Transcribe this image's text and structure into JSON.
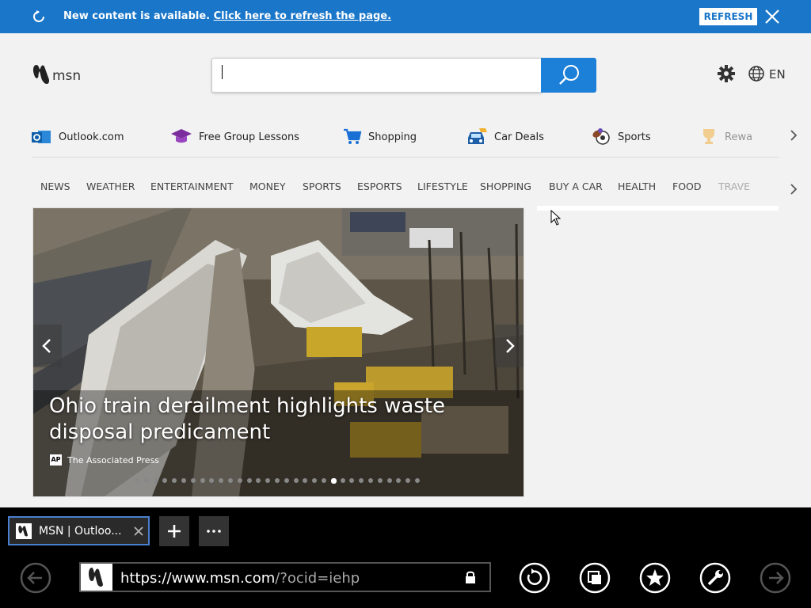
{
  "banner": {
    "message": "New content is available.",
    "link": "Click here to refresh the page.",
    "refresh_label": "REFRESH"
  },
  "header": {
    "logo_text": "msn",
    "search_value": "",
    "language": "EN"
  },
  "quick_links": [
    {
      "label": "Outlook.com",
      "icon": "outlook-icon"
    },
    {
      "label": "Free Group Lessons",
      "icon": "graduation-cap-icon"
    },
    {
      "label": "Shopping",
      "icon": "shopping-cart-icon"
    },
    {
      "label": "Car Deals",
      "icon": "car-icon"
    },
    {
      "label": "Sports",
      "icon": "sports-balls-icon"
    },
    {
      "label": "Rewa",
      "icon": "trophy-icon"
    }
  ],
  "nav": [
    "NEWS",
    "WEATHER",
    "ENTERTAINMENT",
    "MONEY",
    "SPORTS",
    "ESPORTS",
    "LIFESTYLE",
    "SHOPPING",
    "BUY A CAR",
    "HEALTH",
    "FOOD",
    "TRAVE"
  ],
  "hero": {
    "title": "Ohio train derailment highlights waste disposal predicament",
    "source": "The Associated Press",
    "source_logo": "AP",
    "slide_count": 31,
    "active_slide": 21
  },
  "browser": {
    "tab_title": "MSN | Outloo...",
    "url_host": "https://www.msn.com",
    "url_path": "/?ocid=iehp"
  },
  "colors": {
    "banner": "#1976c9",
    "search_button": "#1c7fd8",
    "browser_chrome": "#000000"
  }
}
